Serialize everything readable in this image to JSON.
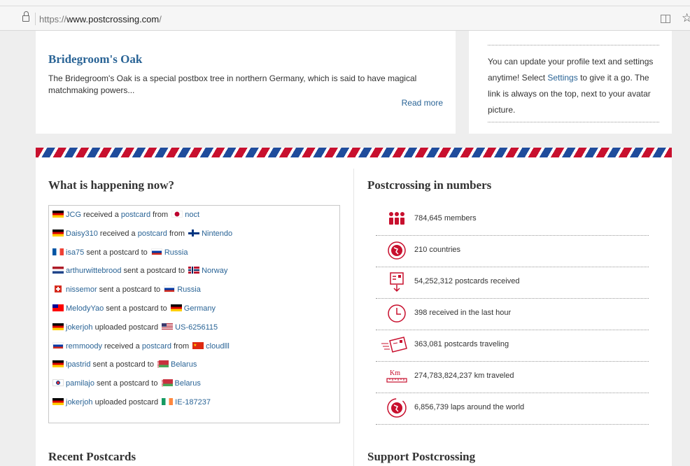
{
  "browser": {
    "url_prefix": "https://",
    "url_host": "www.postcrossing.com",
    "url_path": "/"
  },
  "oak_card": {
    "title": "Bridegroom's Oak",
    "text": "The Bridegroom's Oak is a special postbox tree in northern Germany, which is said to have magical matchmaking powers...",
    "read_more": "Read more"
  },
  "tip_card": {
    "text_before": "You can update your profile text and settings anytime! Select ",
    "link": "Settings",
    "text_after": " to give it a go. The link is always on the top, next to your avatar picture."
  },
  "happening": {
    "title": "What is happening now?",
    "items": [
      {
        "flag": "de",
        "user": "JCG",
        "action": " received a ",
        "link": "postcard",
        "middle": " from ",
        "flag2": "jp",
        "target": "noct"
      },
      {
        "flag": "de",
        "user": "Daisy310",
        "action": " received a ",
        "link": "postcard",
        "middle": " from ",
        "flag2": "fi",
        "target": "Nintendo"
      },
      {
        "flag": "fr",
        "user": "isa75",
        "action": " sent a postcard to ",
        "link": "",
        "middle": "",
        "flag2": "ru",
        "target": "Russia"
      },
      {
        "flag": "nl",
        "user": "arthurwittebrood",
        "action": " sent a postcard to ",
        "link": "",
        "middle": "",
        "flag2": "no",
        "target": "Norway"
      },
      {
        "flag": "ch",
        "user": "nissemor",
        "action": " sent a postcard to ",
        "link": "",
        "middle": "",
        "flag2": "ru",
        "target": "Russia"
      },
      {
        "flag": "tw",
        "user": "MelodyYao",
        "action": " sent a postcard to ",
        "link": "",
        "middle": "",
        "flag2": "de",
        "target": "Germany"
      },
      {
        "flag": "de",
        "user": "jokerjoh",
        "action": " uploaded postcard ",
        "link": "",
        "middle": "",
        "flag2": "us",
        "target": "US-6256115"
      },
      {
        "flag": "ru",
        "user": "remmoody",
        "action": " received a ",
        "link": "postcard",
        "middle": " from ",
        "flag2": "cn",
        "target": "cloudlll"
      },
      {
        "flag": "de",
        "user": "lpastrid",
        "action": " sent a postcard to ",
        "link": "",
        "middle": "",
        "flag2": "by",
        "target": "Belarus"
      },
      {
        "flag": "kr",
        "user": "pamilajo",
        "action": " sent a postcard to ",
        "link": "",
        "middle": "",
        "flag2": "by",
        "target": "Belarus"
      },
      {
        "flag": "de",
        "user": "jokerjoh",
        "action": " uploaded postcard ",
        "link": "",
        "middle": "",
        "flag2": "ie",
        "target": "IE-187237"
      }
    ]
  },
  "numbers": {
    "title": "Postcrossing in numbers",
    "stats": [
      {
        "icon": "members-icon",
        "label": "784,645 members"
      },
      {
        "icon": "globe-icon",
        "label": "210 countries"
      },
      {
        "icon": "postcard-received-icon",
        "label": "54,252,312 postcards received"
      },
      {
        "icon": "clock-icon",
        "label": "398 received in the last hour"
      },
      {
        "icon": "postcard-traveling-icon",
        "label": "363,081 postcards traveling"
      },
      {
        "icon": "ruler-km-icon",
        "label": "274,783,824,237 km traveled"
      },
      {
        "icon": "laps-globe-icon",
        "label": "6,856,739 laps around the world"
      }
    ]
  },
  "bottom": {
    "recent": "Recent Postcards",
    "support": "Support Postcrossing"
  },
  "colors": {
    "link": "#2a6496",
    "accent_red": "#c8102e",
    "accent_blue": "#1f4c9c"
  }
}
